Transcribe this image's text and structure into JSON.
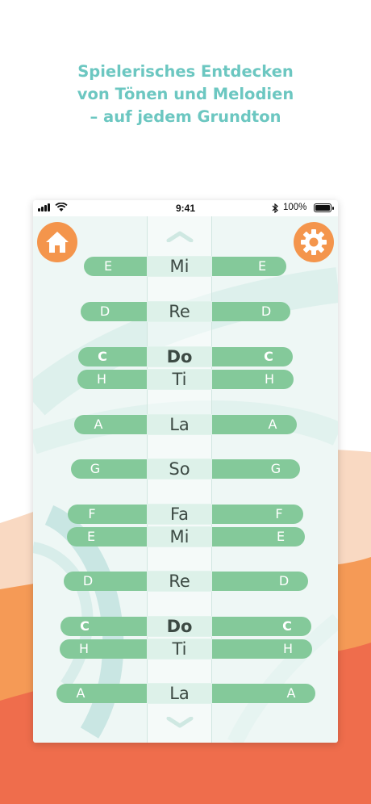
{
  "headline": {
    "line1": "Spielerisches Entdecken",
    "line2": "von Tönen und Melodien",
    "line3": "– auf jedem Grundton"
  },
  "colors": {
    "headline_teal": "#6cc7c1",
    "pill_green": "#84c99a",
    "button_orange": "#f4954c",
    "wave_peach": "#f9d9c2",
    "wave_orange": "#f59a56",
    "wave_red": "#ef6d4c"
  },
  "status_bar": {
    "time": "9:41",
    "battery": "100%"
  },
  "icons": {
    "home": "home-icon",
    "settings": "gear-icon",
    "scroll_up": "chevron-up-icon",
    "scroll_down": "chevron-down-icon"
  },
  "rows": [
    {
      "left": "E",
      "center": "Mi",
      "right": "E",
      "bold": false
    },
    {
      "left": "D",
      "center": "Re",
      "right": "D",
      "bold": false
    },
    {
      "left": "C",
      "center": "Do",
      "right": "C",
      "bold": true
    },
    {
      "left": "H",
      "center": "Ti",
      "right": "H",
      "bold": false
    },
    {
      "left": "A",
      "center": "La",
      "right": "A",
      "bold": false
    },
    {
      "left": "G",
      "center": "So",
      "right": "G",
      "bold": false
    },
    {
      "left": "F",
      "center": "Fa",
      "right": "F",
      "bold": false
    },
    {
      "left": "E",
      "center": "Mi",
      "right": "E",
      "bold": false
    },
    {
      "left": "D",
      "center": "Re",
      "right": "D",
      "bold": false
    },
    {
      "left": "C",
      "center": "Do",
      "right": "C",
      "bold": true
    },
    {
      "left": "H",
      "center": "Ti",
      "right": "H",
      "bold": false
    },
    {
      "left": "A",
      "center": "La",
      "right": "A",
      "bold": false
    }
  ]
}
